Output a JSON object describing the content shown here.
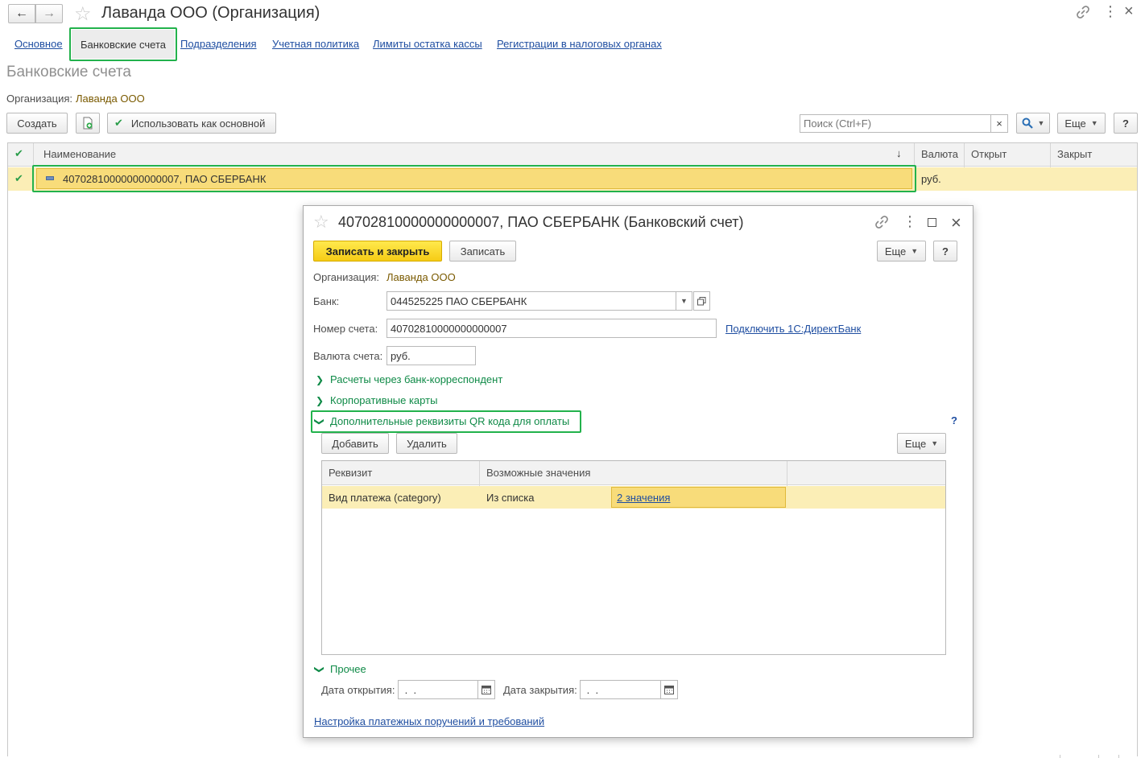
{
  "window": {
    "title": "Лаванда ООО (Организация)",
    "back_icon": "arrow-left-icon",
    "forward_icon": "arrow-right-icon",
    "favorite_icon": "star-icon"
  },
  "tabs": [
    {
      "label": "Основное",
      "active": false
    },
    {
      "label": "Банковские счета",
      "active": true
    },
    {
      "label": "Подразделения",
      "active": false
    },
    {
      "label": "Учетная политика",
      "active": false
    },
    {
      "label": "Лимиты остатка кассы",
      "active": false
    },
    {
      "label": "Регистрации в налоговых органах",
      "active": false
    }
  ],
  "page": {
    "title": "Банковские счета",
    "org_label": "Организация:",
    "org_value": "Лаванда ООО"
  },
  "toolbar": {
    "create": "Создать",
    "use_as_main": "Использовать как основной",
    "search_placeholder": "Поиск (Ctrl+F)",
    "clear": "×",
    "more": "Еще",
    "help": "?"
  },
  "list": {
    "columns": [
      "Наименование",
      "Валюта",
      "Открыт",
      "Закрыт"
    ],
    "sort_indicator": "↓",
    "rows": [
      {
        "name": "40702810000000000007, ПАО СБЕРБАНК",
        "currency": "руб.",
        "opened": "",
        "closed": ""
      }
    ]
  },
  "dialog": {
    "title": "40702810000000000007, ПАО СБЕРБАНК (Банковский счет)",
    "save_close": "Записать и закрыть",
    "save": "Записать",
    "more": "Еще",
    "help": "?",
    "org_label": "Организация:",
    "org_value": "Лаванда ООО",
    "bank_label": "Банк:",
    "bank_value": "044525225 ПАО СБЕРБАНК",
    "account_label": "Номер счета:",
    "account_value": "40702810000000000007",
    "directbank_link": "Подключить 1С:ДиректБанк",
    "currency_label": "Валюта счета:",
    "currency_value": "руб.",
    "section_corr": "Расчеты через банк-корреспондент",
    "section_cards": "Корпоративные карты",
    "section_qr": "Дополнительные реквизиты QR кода для оплаты",
    "qr_help": "?",
    "add": "Добавить",
    "delete": "Удалить",
    "qr_more": "Еще",
    "qr_table": {
      "columns": [
        "Реквизит",
        "Возможные значения"
      ],
      "rows": [
        {
          "attr": "Вид платежа (category)",
          "kind": "Из списка",
          "values_link": "2 значения"
        }
      ]
    },
    "section_other": "Прочее",
    "date_open_label": "Дата открытия:",
    "date_open_value": " .  .",
    "date_close_label": "Дата закрытия:",
    "date_close_value": " .  .",
    "settings_link": "Настройка платежных поручений и требований"
  },
  "colors": {
    "accent_green": "#22b24c",
    "section_green": "#0f8a47",
    "link_blue": "#1f4ea1",
    "row_highlight": "#fbeeb6",
    "primary_button": "#f6cc15"
  }
}
